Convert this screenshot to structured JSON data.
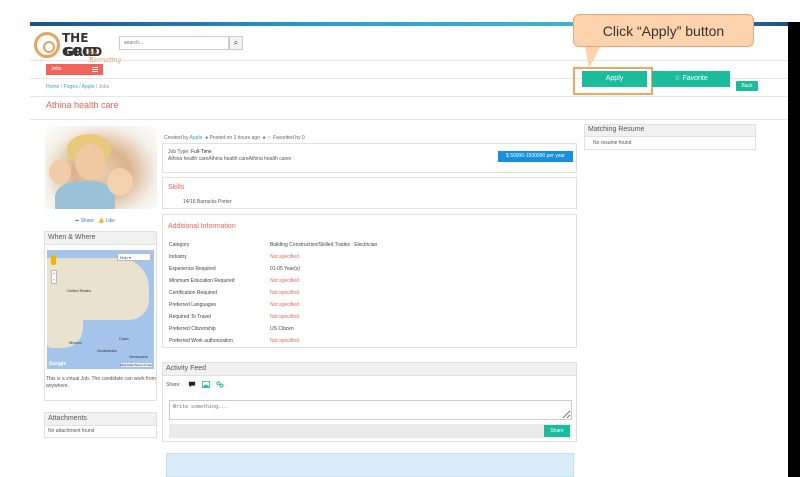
{
  "brand": {
    "line1": "THE GOOD",
    "line2": "GRID",
    "tagline": "for Recruiting"
  },
  "search": {
    "placeholder": "search..."
  },
  "nav": {
    "jobs_label": "Jobs"
  },
  "breadcrumb": [
    "Home",
    "Pages",
    "Apple",
    "Jobs"
  ],
  "header": {
    "title": "Athina health care",
    "back_label": "Back"
  },
  "actions": {
    "apply_label": "Apply",
    "favorite_label": "Favorite"
  },
  "callout": {
    "text": "Click “Apply” button"
  },
  "left": {
    "share_label": "Share",
    "like_label": "Like",
    "when_where_title": "When & Where",
    "map": {
      "type_label": "Map",
      "labels": [
        "United States",
        "Mexico",
        "Cuba",
        "Guatemala",
        "Venezuela"
      ],
      "brand": "Google",
      "terms": "Map Data   Terms of Use"
    },
    "virtual_text": "This is a virtual Job. The candidate can work from anywhere.",
    "attachments_title": "Attachments",
    "attachments_empty": "No attachment found"
  },
  "job": {
    "created_prefix": "Created by",
    "created_by": "Apple",
    "posted": "Posted on 3 hours ago",
    "favorited": "Favorited by 0",
    "type_label": "Job Type:",
    "type_value": "Full-Time",
    "description": "Athina health careAthina health careAthina health carev",
    "salary": "$ 50000-1500000 per year"
  },
  "skills": {
    "title": "Skills",
    "value": "14/16 Barracks Porter"
  },
  "additional": {
    "title": "Additional Information",
    "rows": [
      {
        "k": "Category",
        "v": "Building Construction/Skilled Trades : Electrician",
        "red": false
      },
      {
        "k": "Industry",
        "v": "Not specified",
        "red": true
      },
      {
        "k": "Experience Required",
        "v": "01-05  Year(s)",
        "red": false
      },
      {
        "k": "Minimum Education Required",
        "v": "Not specified",
        "red": true
      },
      {
        "k": "Certification Required",
        "v": "Not specified",
        "red": true
      },
      {
        "k": "Preferred Languages",
        "v": "Not specified",
        "red": true
      },
      {
        "k": "Required To Travel",
        "v": "Not specified",
        "red": true
      },
      {
        "k": "Preferred Citizenship",
        "v": "US Citizen",
        "red": false
      },
      {
        "k": "Preferred Work authorization",
        "v": "Not specified",
        "red": true
      }
    ]
  },
  "feed": {
    "title": "Activity Feed",
    "share_label": "Share:",
    "placeholder": "Write something...",
    "share_button": "Share"
  },
  "matching": {
    "title": "Matching Resume",
    "empty": "No resume found"
  }
}
